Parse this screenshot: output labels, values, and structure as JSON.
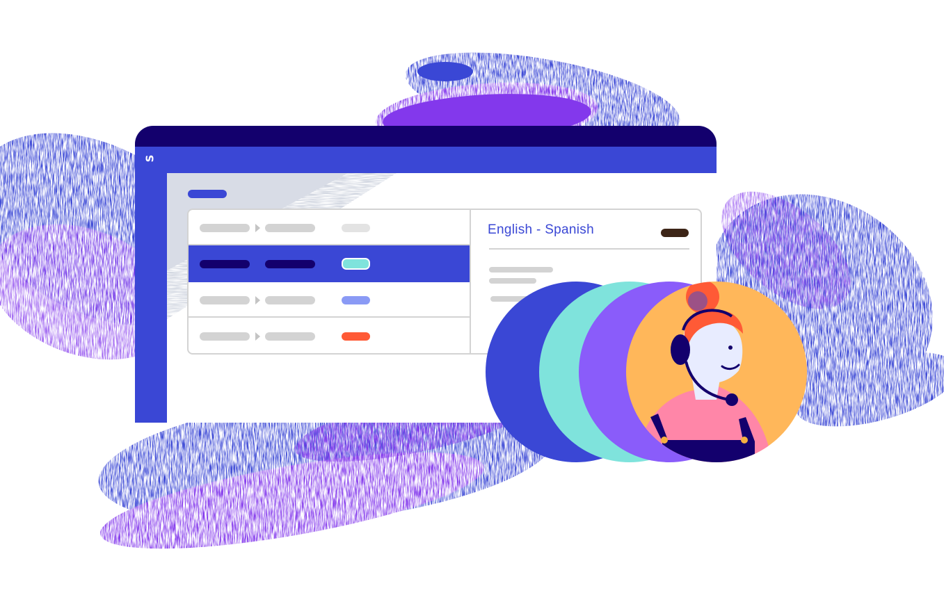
{
  "app": {
    "logo_text": "S",
    "accent_color": "#3a47d5",
    "titlebar_color": "#13006d",
    "sidebar_color": "#3a47d5"
  },
  "list": {
    "rows": [
      {
        "state": "default",
        "status_color": "#e3e3e3"
      },
      {
        "state": "selected",
        "status_color": "#7fe3dc"
      },
      {
        "state": "default",
        "status_color": "#8a9af5"
      },
      {
        "state": "default",
        "status_color": "#ff5a36"
      }
    ]
  },
  "detail": {
    "title": "English - Spanish",
    "badge_color": "#3d2517"
  },
  "avatar_stack": {
    "circle_colors": [
      "#3a47d5",
      "#7fe3dc",
      "#8a5cfa",
      "#ffb75a"
    ],
    "agent_icon": "support-agent-headset-icon"
  }
}
